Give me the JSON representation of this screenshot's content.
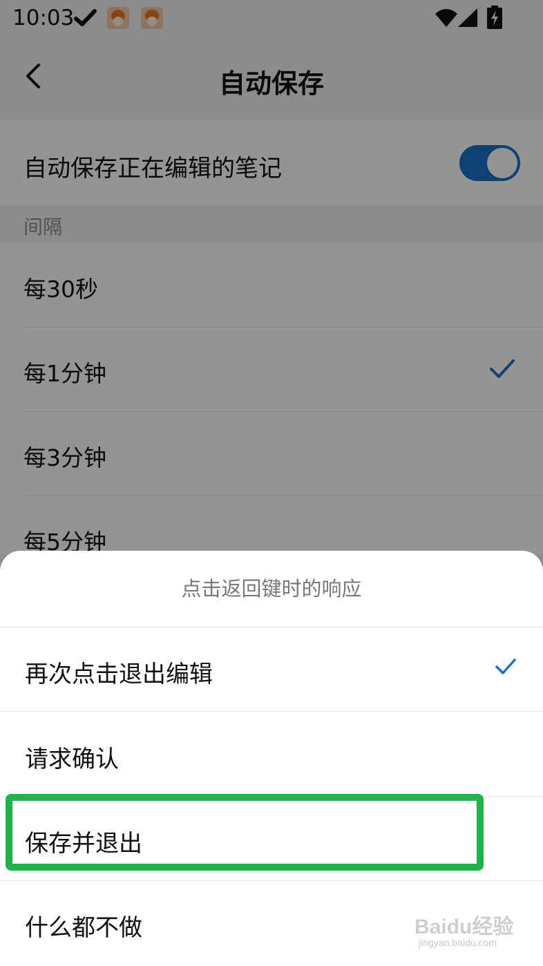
{
  "status_bar": {
    "time": "10:03",
    "icons": [
      "check-icon",
      "app-notification-icon",
      "app-notification-icon",
      "wifi-icon",
      "signal-icon",
      "battery-charging-icon"
    ]
  },
  "header": {
    "title": "自动保存",
    "back_icon": "back-arrow-icon"
  },
  "auto_save": {
    "label": "自动保存正在编辑的笔记",
    "enabled": true
  },
  "interval": {
    "section_title": "间隔",
    "options": [
      {
        "label": "每30秒",
        "selected": false
      },
      {
        "label": "每1分钟",
        "selected": true
      },
      {
        "label": "每3分钟",
        "selected": false
      },
      {
        "label": "每5分钟",
        "selected": false
      }
    ]
  },
  "back_key_sheet": {
    "title": "点击返回键时的响应",
    "options": [
      {
        "label": "再次点击退出编辑",
        "selected": true
      },
      {
        "label": "请求确认",
        "selected": false
      },
      {
        "label": "保存并退出",
        "selected": false,
        "highlighted": true
      },
      {
        "label": "什么都不做",
        "selected": false
      }
    ]
  },
  "watermark": {
    "brand": "Baidu经验",
    "url": "jingyan.baidu.com"
  },
  "colors": {
    "accent": "#1a73c7",
    "highlight": "#20b34a",
    "scrim": "rgba(0,0,0,0.42)"
  }
}
